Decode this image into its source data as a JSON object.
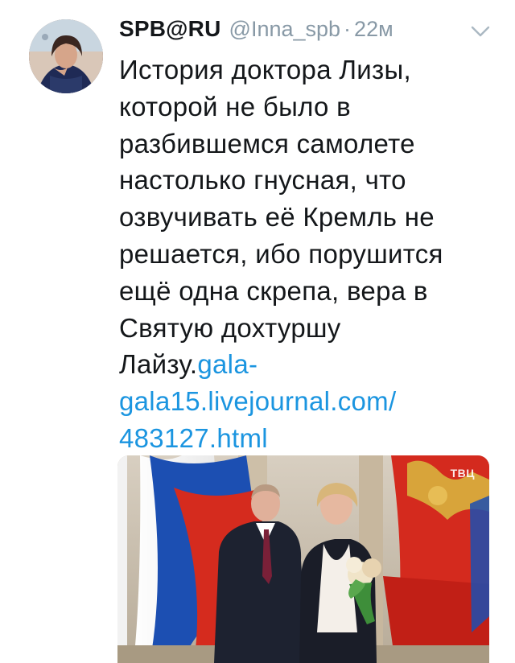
{
  "tweet": {
    "display_name": "SPB@RU",
    "handle": "@Inna_spb",
    "separator": "·",
    "time": "22м",
    "text_lines": [
      "История доктора Лизы,",
      "которой не было в",
      "разбившемся самолете",
      "настолько гнусная, что",
      "озвучивать её Кремль не",
      "решается, ибо порушится",
      "ещё одна скрепа, вера в",
      "Святую дохтуршу"
    ],
    "text_last_prefix": "Лайзу.",
    "link_lines": [
      "gala-",
      "gala15.livejournal.com/",
      "483127.html"
    ],
    "media": {
      "channel_logo": "ТВЦ"
    }
  },
  "colors": {
    "text": "#14171a",
    "muted": "#8899a6",
    "link": "#1b95e0"
  },
  "icons": {
    "caret": "chevron-down-icon"
  }
}
